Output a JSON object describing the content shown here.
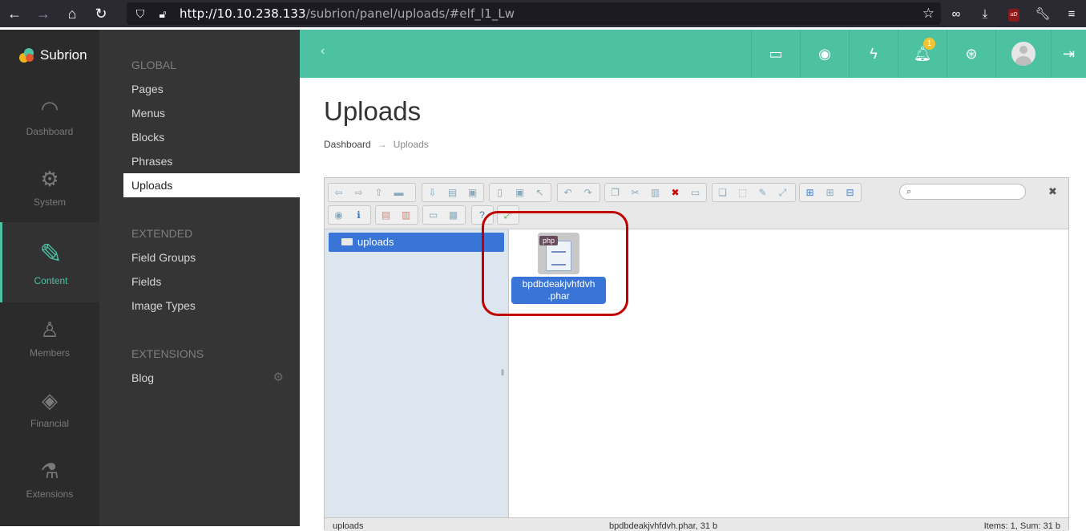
{
  "browser": {
    "url_host": "http://10.10.238.133",
    "url_path": "/subrion/panel/uploads/#elf_l1_Lw"
  },
  "app": {
    "logo_text": "Subrion"
  },
  "iconbar": {
    "items": [
      {
        "label": "Dashboard",
        "icon": "speedometer-icon"
      },
      {
        "label": "System",
        "icon": "gear-icon"
      },
      {
        "label": "Content",
        "icon": "pencil-icon",
        "active": true
      },
      {
        "label": "Members",
        "icon": "user-icon"
      },
      {
        "label": "Financial",
        "icon": "money-icon"
      },
      {
        "label": "Extensions",
        "icon": "flask-icon"
      }
    ]
  },
  "submenu": {
    "global_title": "GLOBAL",
    "global_items": [
      "Pages",
      "Menus",
      "Blocks",
      "Phrases",
      "Uploads"
    ],
    "extended_title": "EXTENDED",
    "extended_items": [
      "Field Groups",
      "Fields",
      "Image Types"
    ],
    "extensions_title": "EXTENSIONS",
    "extensions_items": [
      "Blog"
    ]
  },
  "topbar": {
    "notification_count": "1"
  },
  "page": {
    "title": "Uploads",
    "breadcrumb": [
      "Dashboard",
      "Uploads"
    ],
    "breadcrumb_sep": "→"
  },
  "filemanager": {
    "tree_root": "uploads",
    "file": {
      "type_tag": "php",
      "name_line1": "bpdbdeakjvhfdvh",
      "name_line2": ".phar"
    },
    "status_left": "uploads",
    "status_mid": "bpdbdeakjvhfdvh.phar, 31 b",
    "status_right": "Items: 1, Sum: 31 b"
  }
}
